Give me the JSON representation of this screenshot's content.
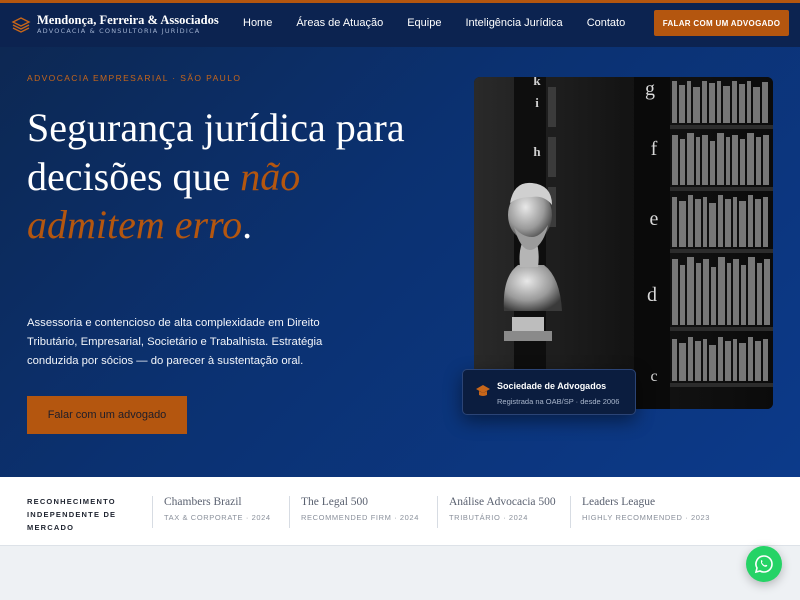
{
  "brand": {
    "name": "Mendonça, Ferreira & Associados",
    "tagline": "ADVOCACIA & CONSULTORIA JURÍDICA",
    "logo_icon": "stacked-layers-icon"
  },
  "nav": {
    "links": [
      "Home",
      "Áreas de Atuação",
      "Equipe",
      "Inteligência Jurídica",
      "Contato"
    ],
    "cta_label": "FALAR COM UM ADVOGADO"
  },
  "hero": {
    "eyebrow": "ADVOCACIA EMPRESARIAL · SÃO PAULO",
    "headline_part1": "Segurança jurídica para decisões que ",
    "headline_accent": "não admitem erro",
    "headline_end": ".",
    "lede": "Assessoria e contencioso de alta complexidade em Direito Tributário, Empresarial, Societário e Trabalhista. Estratégia conduzida por sócios — do parecer à sustentação oral.",
    "cta_label": "Falar com um advogado"
  },
  "badge": {
    "title": "Sociedade de Advogados",
    "subtitle": "Registrada na OAB/SP · desde 2006",
    "icon": "graduation-cap-icon"
  },
  "photo": {
    "shelf_letters": [
      "k",
      "i",
      "h",
      "g",
      "f",
      "e",
      "d",
      "c"
    ]
  },
  "recognition": {
    "label": "RECONHECIMENTO INDEPENDENTE DE MERCADO",
    "awards": [
      {
        "name": "Chambers Brazil",
        "meta": "TAX & CORPORATE · 2024"
      },
      {
        "name": "The Legal 500",
        "meta": "RECOMMENDED FIRM · 2024"
      },
      {
        "name": "Análise Advocacia 500",
        "meta": "TRIBUTÁRIO · 2024"
      },
      {
        "name": "Leaders League",
        "meta": "HIGHLY RECOMMENDED · 2023"
      }
    ]
  },
  "colors": {
    "accent": "#b4560f",
    "navy": "#0c2350",
    "whatsapp": "#25d366"
  },
  "whatsapp": {
    "icon": "whatsapp-icon"
  }
}
